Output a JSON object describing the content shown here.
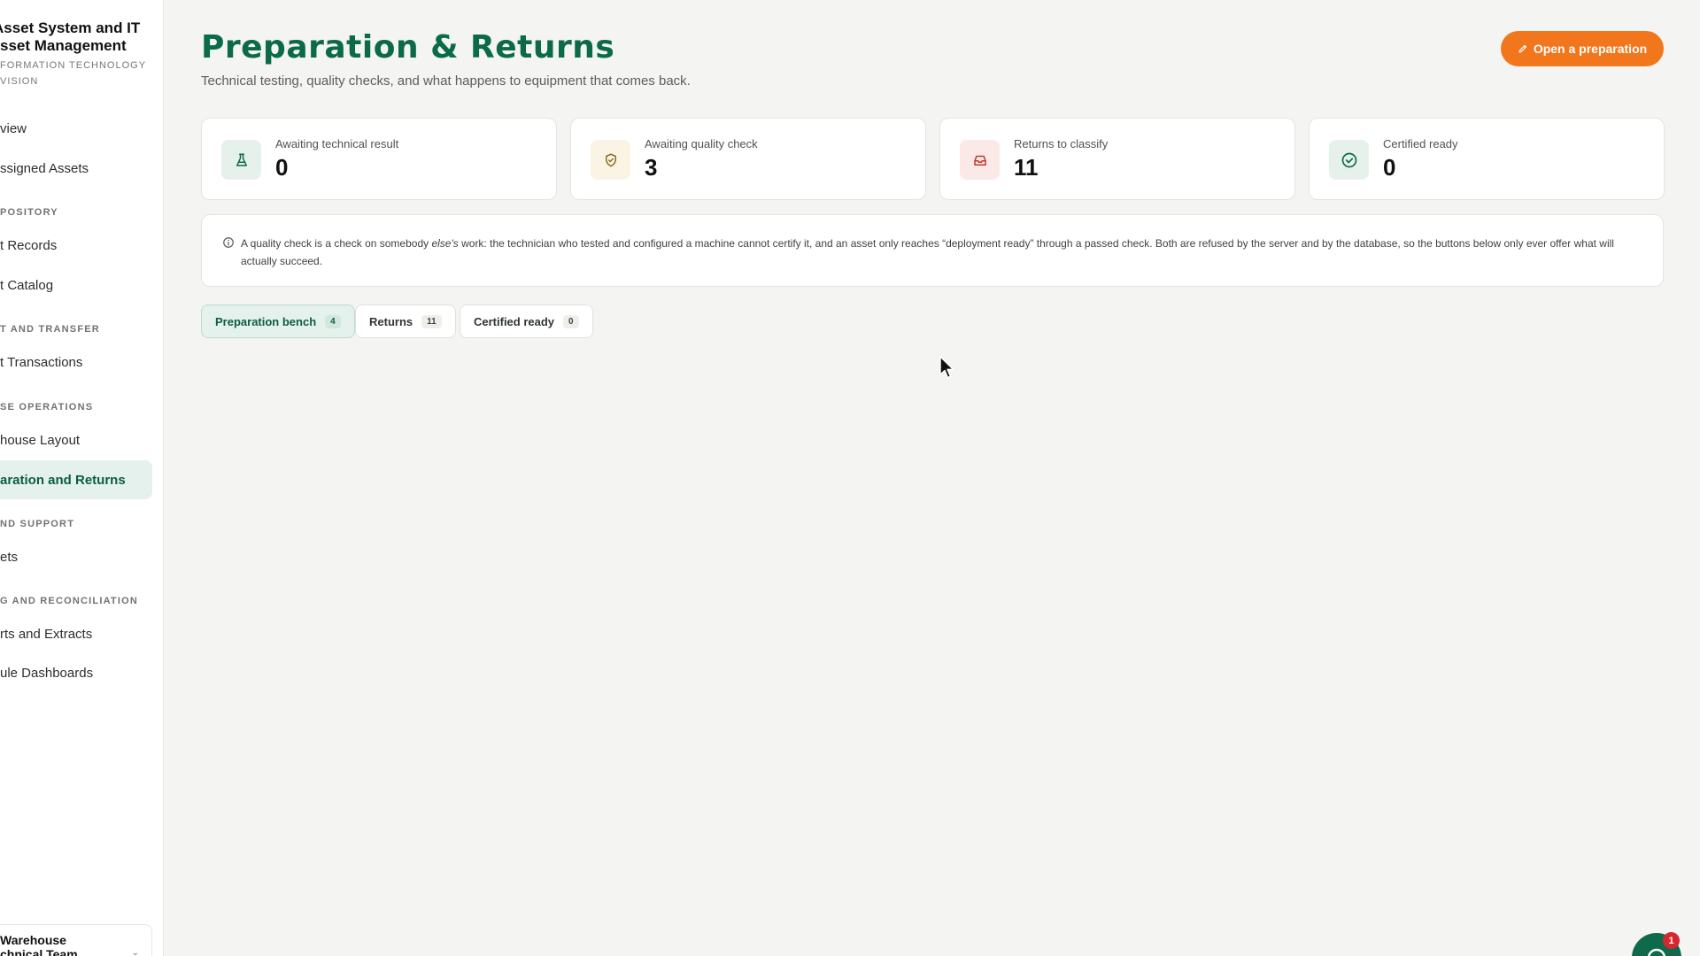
{
  "sidebar": {
    "brand_title_line1": "Asset System and IT",
    "brand_title_line2": "sset Management",
    "brand_sub_line1": "FORMATION TECHNOLOGY",
    "brand_sub_line2": "VISION",
    "items": [
      {
        "label": "view"
      },
      {
        "label": "ssigned Assets"
      },
      {
        "section": "POSITORY"
      },
      {
        "label": "t Records"
      },
      {
        "label": "t Catalog"
      },
      {
        "section": "T AND TRANSFER"
      },
      {
        "label": "t Transactions"
      },
      {
        "section": "SE OPERATIONS"
      },
      {
        "label": "house Layout"
      },
      {
        "label": "aration and Returns",
        "active": true
      },
      {
        "section": "ND SUPPORT"
      },
      {
        "label": "ets"
      },
      {
        "section": "G AND RECONCILIATION"
      },
      {
        "label": "rts and Extracts"
      },
      {
        "label": "ule Dashboards"
      }
    ],
    "team_line1": "Warehouse",
    "team_line2": "chnical Team"
  },
  "header": {
    "title": "Preparation & Returns",
    "subtitle": "Technical testing, quality checks, and what happens to equipment that comes back.",
    "primary_button": "Open a preparation"
  },
  "stats": [
    {
      "label": "Awaiting technical result",
      "value": "0",
      "icon": "flask-icon",
      "color": "#0b6a4a",
      "bg": "#e6f1ec"
    },
    {
      "label": "Awaiting quality check",
      "value": "3",
      "icon": "shield-check-icon",
      "color": "#b7791f",
      "bg": "#fbf4e4"
    },
    {
      "label": "Returns to classify",
      "value": "11",
      "icon": "inbox-icon",
      "color": "#c0392b",
      "bg": "#fbe9e7"
    },
    {
      "label": "Certified ready",
      "value": "0",
      "icon": "check-circle-icon",
      "color": "#0b6a4a",
      "bg": "#e6f1ec"
    }
  ],
  "notice": {
    "text_before": "A quality check is a check on somebody ",
    "text_em": "else's",
    "text_after": " work: the technician who tested and configured a machine cannot certify it, and an asset only reaches “deployment ready” through a passed check. Both are refused by the server and by the database, so the buttons below only ever offer what will actually succeed."
  },
  "tabs": [
    {
      "label": "Preparation bench",
      "count": "4",
      "active": true
    },
    {
      "label": "Returns",
      "count": "11"
    },
    {
      "label": "Certified ready",
      "count": "0"
    }
  ],
  "chat": {
    "badge": "1"
  }
}
